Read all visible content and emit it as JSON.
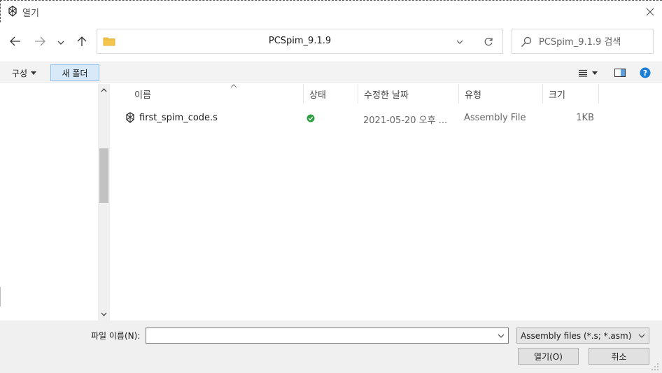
{
  "window": {
    "title": "열기",
    "colors": {
      "accent": "#0078d7",
      "toolbar_bg": "#f3f3f3",
      "status_ok": "#2ea043",
      "help": "#1b7ed6"
    }
  },
  "navigation": {
    "back_icon": "arrow-left-icon",
    "forward_icon": "arrow-right-icon",
    "recent_icon": "chevron-down-icon",
    "up_icon": "arrow-up-icon"
  },
  "address": {
    "path": "PCSpim_9.1.9"
  },
  "search": {
    "placeholder": "PCSpim_9.1.9 검색"
  },
  "toolbar": {
    "organize_label": "구성",
    "new_folder_label": "새 폴더"
  },
  "file_list": {
    "columns": [
      "이름",
      "상태",
      "수정한 날짜",
      "유형",
      "크기"
    ],
    "rows": [
      {
        "name": "first_spim_code.s",
        "status_icon": "synced-check-icon",
        "modified": "2021-05-20 오후 ...",
        "type": "Assembly File",
        "size": "1KB"
      }
    ]
  },
  "bottom": {
    "filename_label": "파일 이름(N):",
    "filename_value": "",
    "filetype_selected": "Assembly files (*.s; *.asm)",
    "open_label": "열기(O)",
    "cancel_label": "취소"
  }
}
